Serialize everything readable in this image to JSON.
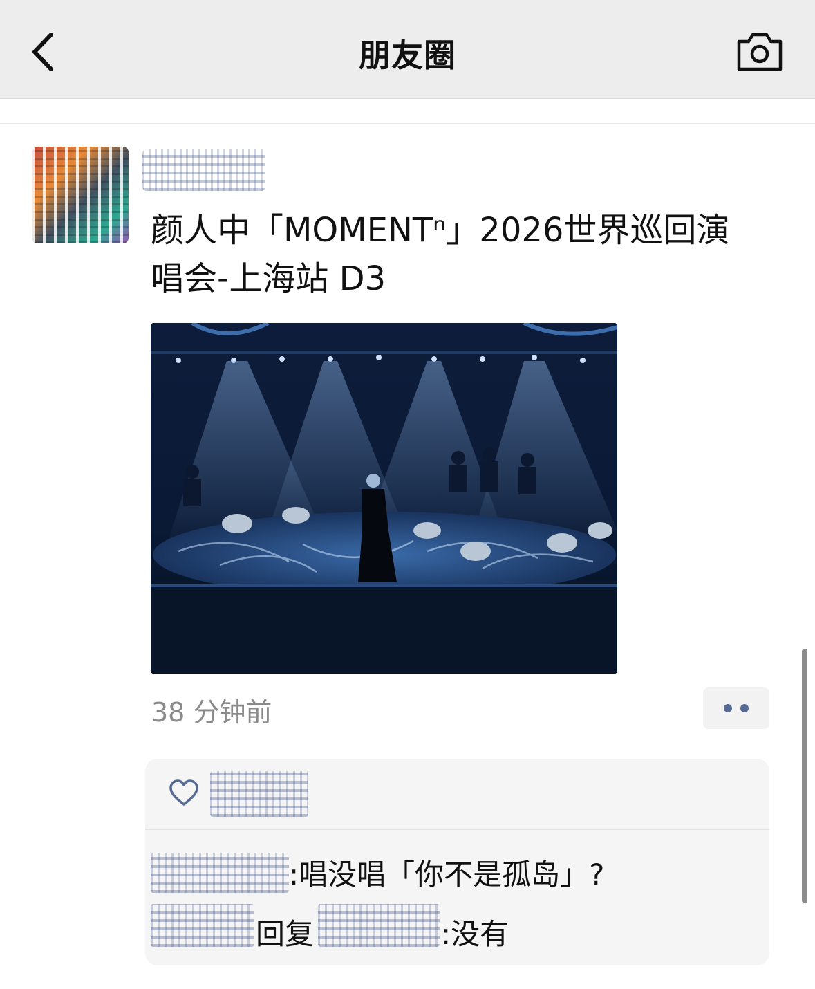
{
  "nav": {
    "title": "朋友圈",
    "back_icon": "chevron-left-icon",
    "camera_icon": "camera-icon"
  },
  "post": {
    "text_line1": "颜人中「MOMENTⁿ」2026世界巡回演",
    "text_line2": "唱会-上海站 D3",
    "time": "38 分钟前"
  },
  "comments": [
    {
      "separator": ":",
      "text": "唱没唱「你不是孤岛」?"
    },
    {
      "reply_label": "回复",
      "separator": ":",
      "text": "没有"
    }
  ],
  "colors": {
    "link": "#576b95",
    "navbar_bg": "#ededed",
    "box_bg": "#f5f5f5"
  }
}
